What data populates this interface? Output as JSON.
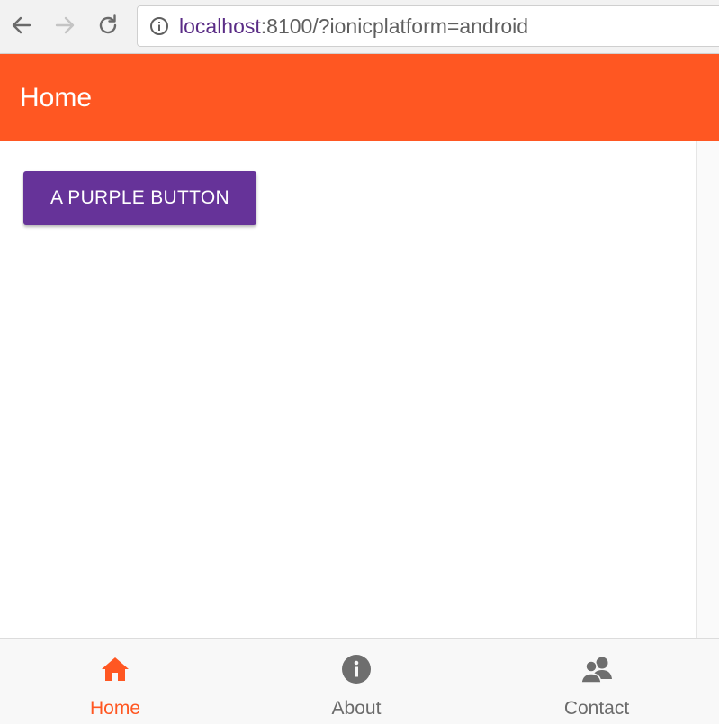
{
  "browser": {
    "url_host": "localhost",
    "url_rest": ":8100/?ionicplatform=android"
  },
  "toolbar": {
    "title": "Home",
    "color": "#ff5722"
  },
  "content": {
    "button_label": "A PURPLE BUTTON",
    "button_color": "#663399"
  },
  "tabs": [
    {
      "label": "Home",
      "icon": "home-icon",
      "active": true
    },
    {
      "label": "About",
      "icon": "info-icon",
      "active": false
    },
    {
      "label": "Contact",
      "icon": "contacts-icon",
      "active": false
    }
  ]
}
